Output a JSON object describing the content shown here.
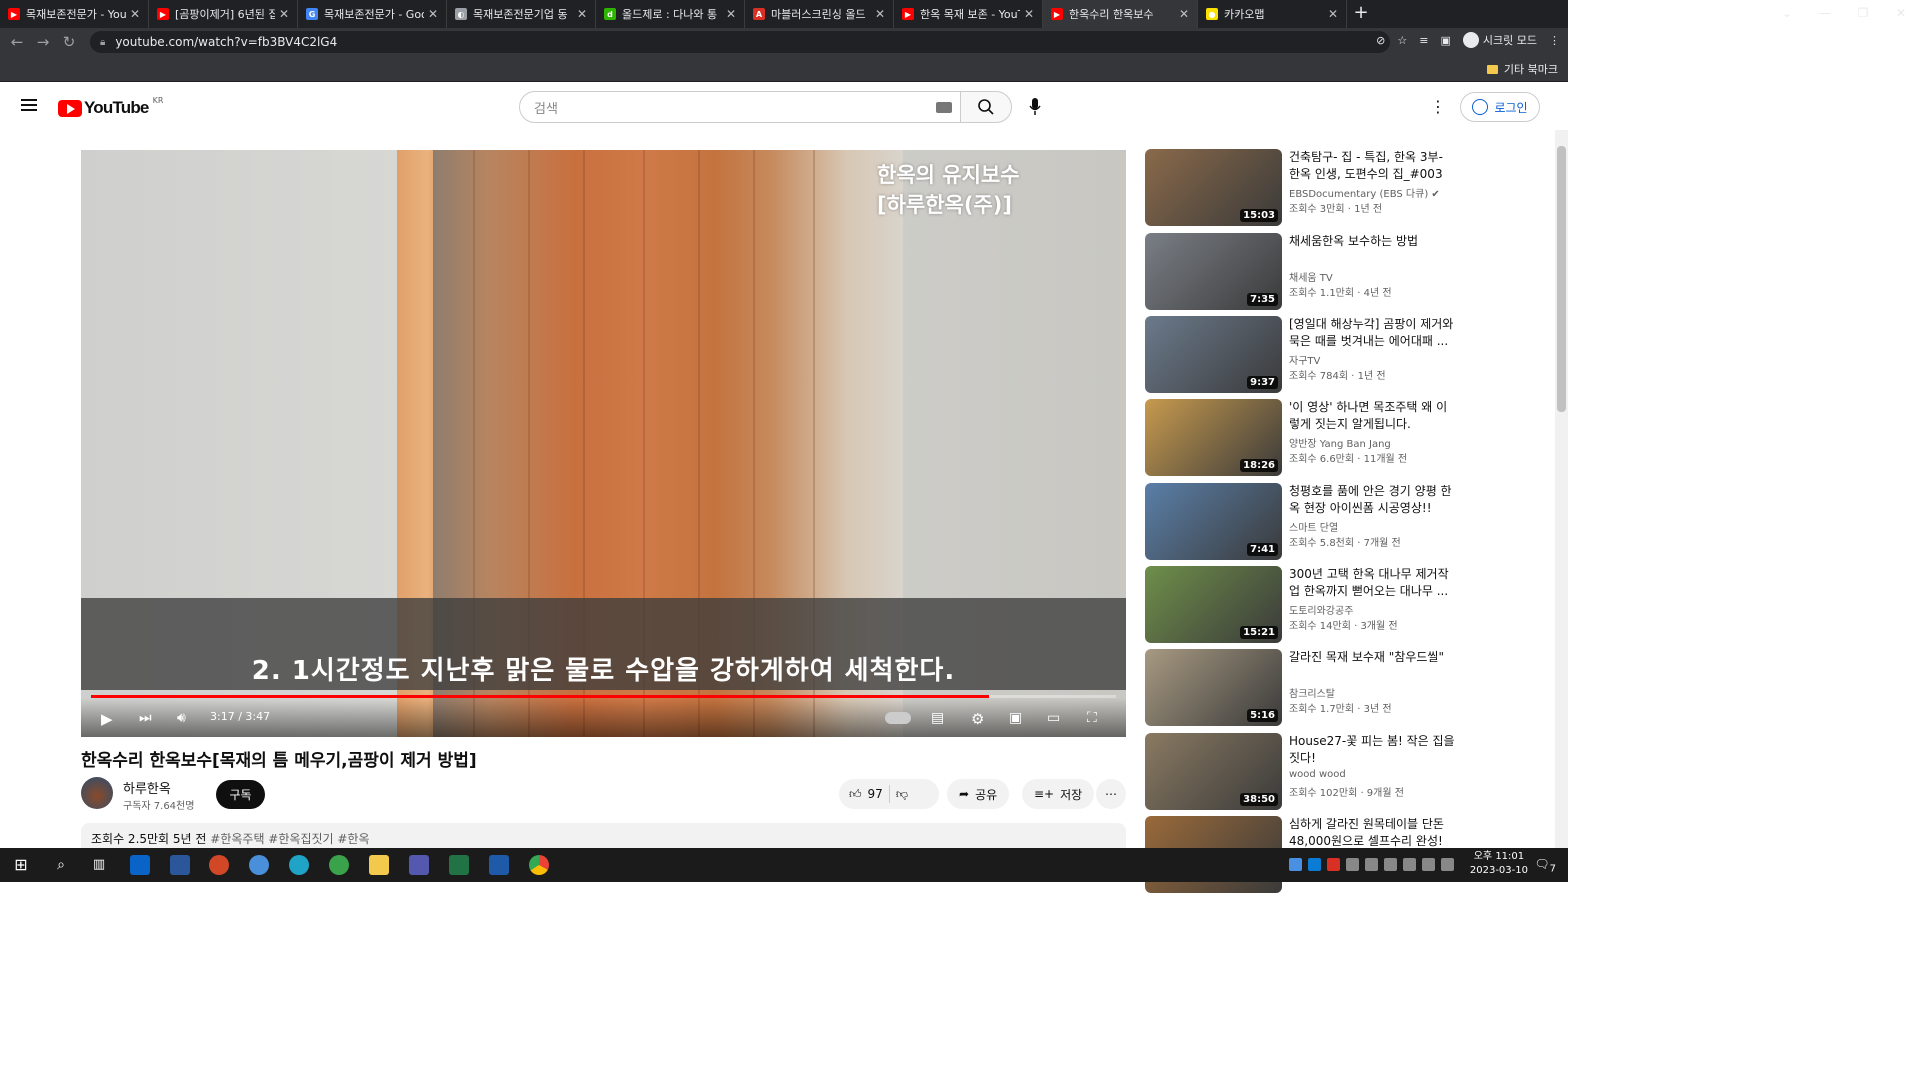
{
  "browser": {
    "tabs": [
      {
        "title": "목재보존전문가 - You",
        "fav_color": "#ff0000",
        "fav_glyph": "▶"
      },
      {
        "title": "[곰팡이제거] 6년된 집",
        "fav_color": "#ff0000",
        "fav_glyph": "▶"
      },
      {
        "title": "목재보존전문가 - Goo",
        "fav_color": "#4285f4",
        "fav_glyph": "G"
      },
      {
        "title": "목재보존전문기업 동",
        "fav_color": "#9aa0a6",
        "fav_glyph": "◐"
      },
      {
        "title": "올드제로 : 다나와 통",
        "fav_color": "#2db400",
        "fav_glyph": "d"
      },
      {
        "title": "마블러스크린싱 올드",
        "fav_color": "#d93025",
        "fav_glyph": "A"
      },
      {
        "title": "한옥 목재 보존 - YouT",
        "fav_color": "#ff0000",
        "fav_glyph": "▶"
      },
      {
        "title": "한옥수리 한옥보수",
        "fav_color": "#ff0000",
        "fav_glyph": "▶",
        "active": true
      },
      {
        "title": "카카오맵",
        "fav_color": "#f9e000",
        "fav_glyph": "●"
      }
    ],
    "url": "youtube.com/watch?v=fb3BV4C2lG4",
    "incognito_label": "시크릿 모드",
    "bookmarks_label": "기타 북마크"
  },
  "header": {
    "logo_text": "YouTube",
    "region": "KR",
    "search_placeholder": "검색",
    "login_label": "로그인"
  },
  "player": {
    "overlay_title_line1": "한옥의 유지보수",
    "overlay_title_line2": "[하루한옥(주)]",
    "subtitle": "2. 1시간정도 지난후 맑은 물로 수압을 강하게하여 세척한다.",
    "time": "3:17 / 3:47",
    "progress_fraction": 0.876
  },
  "video": {
    "title": "한옥수리 한옥보수[목재의 틈 메우기,곰팡이 제거 방법]",
    "channel": "하루한옥",
    "subscribers": "구독자 7.64천명",
    "subscribe_label": "구독",
    "likes": "97",
    "share_label": "공유",
    "save_label": "저장",
    "views_age": "조회수 2.5만회  5년 전",
    "hashtags": "#한옥주택 #한옥집짓기 #한옥"
  },
  "recommendations": [
    {
      "title": "건축탐구- 집 - 특집, 한옥 3부- 한옥 인생, 도편수의 집_#003",
      "channel": "EBSDocumentary (EBS 다큐)",
      "verified": true,
      "meta": "조회수 3만회 · 1년 전",
      "duration": "15:03",
      "thumb": "#8a6a4a"
    },
    {
      "title": "채세움한옥 보수하는 방법",
      "channel": "채세움 TV",
      "verified": false,
      "meta": "조회수 1.1만회 · 4년 전",
      "duration": "7:35",
      "thumb": "#7a7f86"
    },
    {
      "title": "[영일대 해상누각] 곰팡이 제거와 묵은 때를 벗겨내는 에어대패 ...",
      "channel": "자구TV",
      "verified": false,
      "meta": "조회수 784회 · 1년 전",
      "duration": "9:37",
      "thumb": "#6b7a8c"
    },
    {
      "title": "'이 영상' 하나면 목조주택 왜 이렇게 짓는지 알게됩니다.",
      "channel": "양반장 Yang Ban Jang",
      "verified": false,
      "meta": "조회수 6.6만회 · 11개월 전",
      "duration": "18:26",
      "thumb": "#c79a4e"
    },
    {
      "title": "청평호를 품에 안은 경기 양평 한옥 현장 아이씬폼 시공영상!! 아...",
      "channel": "스마트 단열",
      "verified": false,
      "meta": "조회수 5.8천회 · 7개월 전",
      "duration": "7:41",
      "thumb": "#5a7fa8"
    },
    {
      "title": "300년 고택 한옥 대나무 제거작업 한옥까지 뻗어오는 대나무 ...",
      "channel": "도토리와강공주",
      "verified": false,
      "meta": "조회수 14만회 · 3개월 전",
      "duration": "15:21",
      "thumb": "#6f8f4a"
    },
    {
      "title": "갈라진 목재 보수재 \"참우드씰\"",
      "channel": "참크리스탈",
      "verified": false,
      "meta": "조회수 1.7만회 · 3년 전",
      "duration": "5:16",
      "thumb": "#a89a82"
    },
    {
      "title": "House27-꽃 피는 봄! 작은 집을 짓다!",
      "channel": "wood wood",
      "verified": false,
      "meta": "조회수 102만회 · 9개월 전",
      "duration": "38:50",
      "thumb": "#8a7a62"
    },
    {
      "title": "심하게 갈라진 원목테이블 단돈 48,000원으로 셀프수리 완성!",
      "channel": "",
      "verified": false,
      "meta": "",
      "duration": "",
      "thumb": "#9a6a3a"
    }
  ],
  "taskbar": {
    "time": "오후 11:01",
    "date": "2023-03-10",
    "notification_count": "7"
  }
}
